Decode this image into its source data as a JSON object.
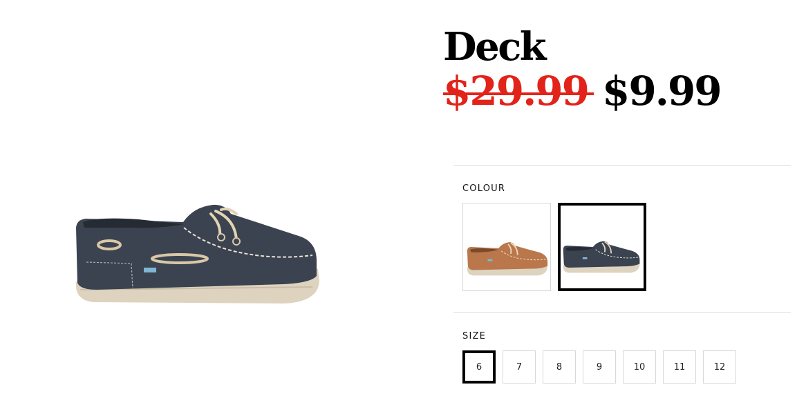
{
  "product": {
    "title": "Deck",
    "price_original": "$29.99",
    "price_sale": "$9.99"
  },
  "colour": {
    "label": "COLOUR",
    "selected_index": 1,
    "swatches": [
      {
        "icon": "tan-boat-shoe-thumbnail",
        "color": "#b9774b"
      },
      {
        "icon": "navy-boat-shoe-thumbnail",
        "color": "#3b4351"
      }
    ]
  },
  "size": {
    "label": "SIZE",
    "selected": "6",
    "options": [
      "6",
      "7",
      "8",
      "9",
      "10",
      "11",
      "12"
    ]
  },
  "colors": {
    "sale_red": "#e2231a",
    "selected_border": "#000000",
    "navy_leather": "#3b4351",
    "tan_leather": "#b9774b",
    "sole": "#ddd3bf"
  }
}
